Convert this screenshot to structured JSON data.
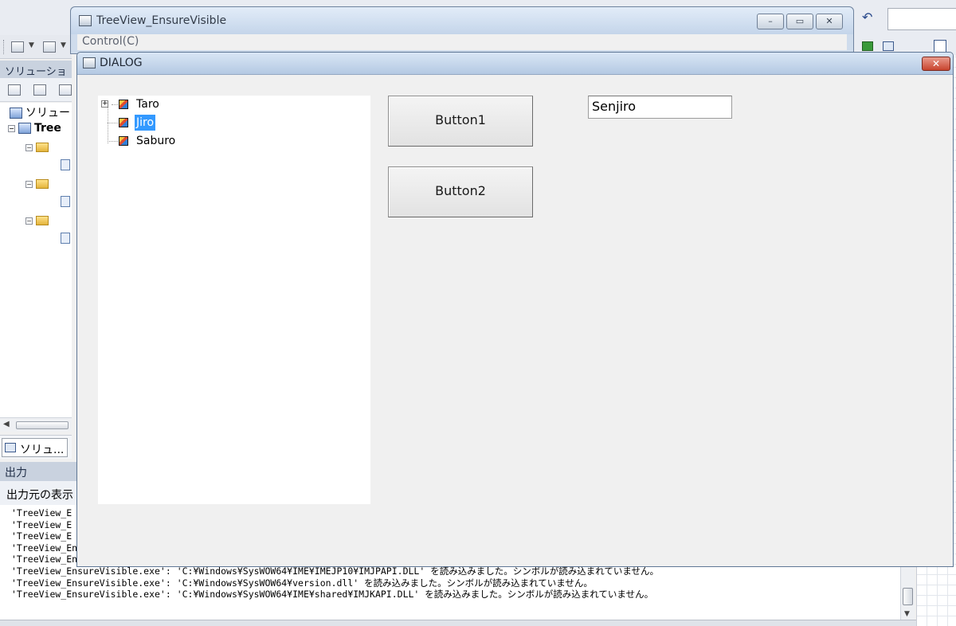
{
  "ide": {
    "solution_header": "ソリューショ",
    "solution_items": [
      "ソリュー",
      "Tree"
    ],
    "solution_tab": "ソリュ...",
    "output_header": "出力",
    "output_source_label": "出力元の表示",
    "output_lines": [
      "'TreeView_E",
      "'TreeView_E",
      "'TreeView_E",
      "'TreeView_En",
      "'TreeView_En",
      "'TreeView_EnsureVisible.exe': 'C:¥Windows¥SysWOW64¥IME¥IMEJP10¥IMJPAPI.DLL' を読み込みました。シンボルが読み込まれていません。",
      "'TreeView_EnsureVisible.exe': 'C:¥Windows¥SysWOW64¥version.dll' を読み込みました。シンボルが読み込まれていません。",
      "'TreeView_EnsureVisible.exe': 'C:¥Windows¥SysWOW64¥IME¥shared¥IMJKAPI.DLL' を読み込みました。シンボルが読み込まれていません。"
    ]
  },
  "main_window": {
    "title": "TreeView_EnsureVisible",
    "menu_control": "Control(C)",
    "minimize": "–",
    "maximize": "▭",
    "close": "✕"
  },
  "dialog": {
    "title": "DIALOG",
    "close": "✕",
    "tree_items": [
      {
        "label": "Taro",
        "expandable": true,
        "selected": false
      },
      {
        "label": "Jiro",
        "expandable": false,
        "selected": true
      },
      {
        "label": "Saburo",
        "expandable": false,
        "selected": false
      }
    ],
    "button1": "Button1",
    "button2": "Button2",
    "edit_value": "Senjiro"
  },
  "colors": {
    "selection": "#3399ff",
    "dialog_close": "#c8442e"
  }
}
